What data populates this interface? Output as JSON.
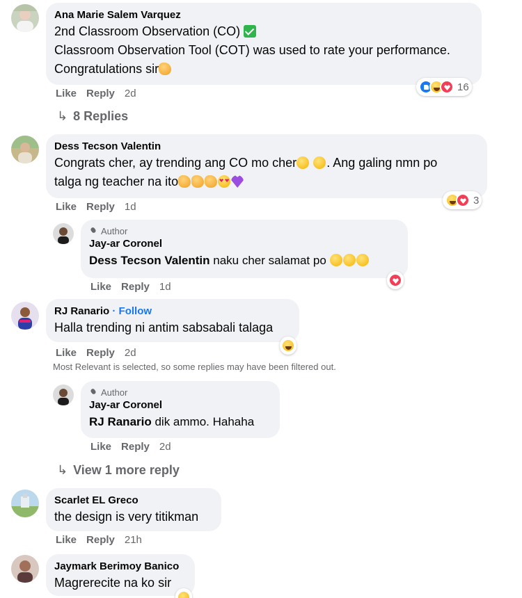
{
  "comments": [
    {
      "author": "Ana Marie Salem Varquez",
      "line1": "2nd Classroom Observation (CO)",
      "line2": "Classroom Observation Tool (COT) was used to rate your performance.",
      "line3": "Congratulations sir",
      "like": "Like",
      "reply": "Reply",
      "time": "2d",
      "reaction_count": "16",
      "replies_link": "8 Replies"
    },
    {
      "author": "Dess Tecson Valentin",
      "line1": "Congrats cher, ay trending ang CO mo cher",
      "line1b": ". Ang galing nmn po",
      "line2": "talga ng teacher na ito",
      "like": "Like",
      "reply": "Reply",
      "time": "1d",
      "reaction_count": "3",
      "reply_item": {
        "badge": "Author",
        "author": "Jay-ar Coronel",
        "tag": "Dess Tecson Valentin",
        "text": " naku cher salamat po ",
        "like": "Like",
        "reply": "Reply",
        "time": "1d"
      }
    },
    {
      "author": "RJ Ranario",
      "follow": "· Follow",
      "text": "Halla trending ni antim sabsabali talaga",
      "like": "Like",
      "reply": "Reply",
      "time": "2d",
      "filter_note": "Most Relevant is selected, so some replies may have been filtered out.",
      "reply_item": {
        "badge": "Author",
        "author": "Jay-ar Coronel",
        "tag": "RJ Ranario",
        "text": " dik ammo. Hahaha",
        "like": "Like",
        "reply": "Reply",
        "time": "2d"
      },
      "more_link": "View 1 more reply"
    },
    {
      "author": "Scarlet EL Greco",
      "text": "the design is very titikman",
      "like": "Like",
      "reply": "Reply",
      "time": "21h"
    },
    {
      "author": "Jaymark Berimoy Banico",
      "text": "Magrerecite na ko sir"
    }
  ],
  "colors": {
    "bubble": "#f0f2f5",
    "secondary_text": "#65676b",
    "link_blue": "#1877f2",
    "like_blue": "#1877f2",
    "love_red": "#f33e58"
  },
  "icons": [
    "check-icon",
    "clap-emoji-icon",
    "grin-emoji-icon",
    "heart-eyes-emoji-icon",
    "purple-heart-emoji-icon",
    "like-reaction-icon",
    "haha-reaction-icon",
    "love-reaction-icon",
    "reply-arrow-icon",
    "author-mic-icon"
  ]
}
